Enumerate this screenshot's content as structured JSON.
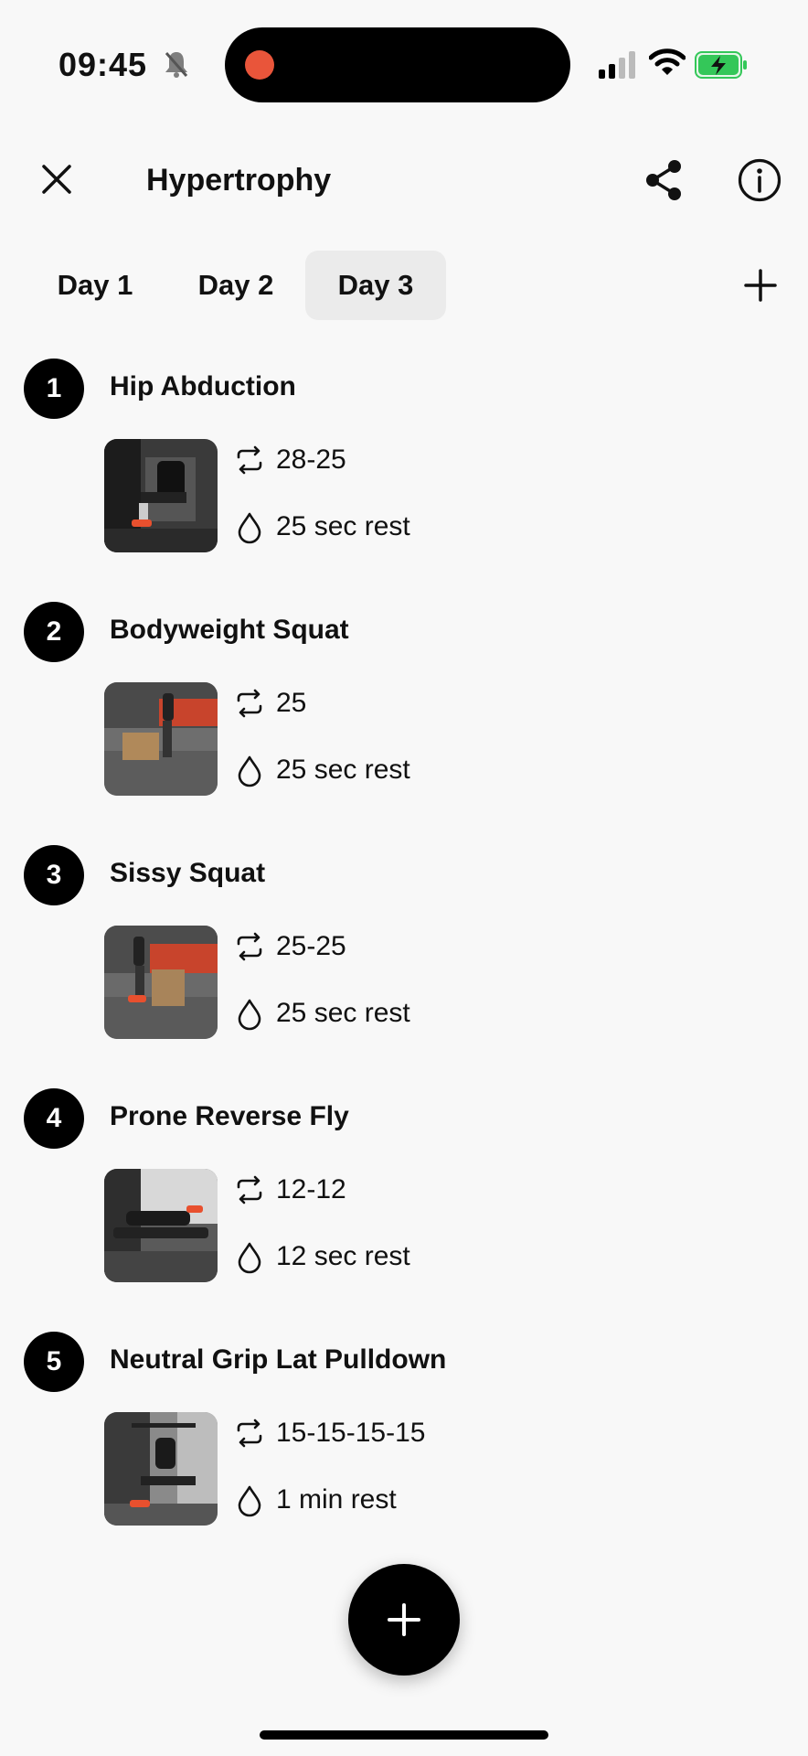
{
  "status_bar": {
    "time": "09:45",
    "bell_icon": "bell-slash-icon",
    "signal_icon": "cellular-signal-icon",
    "wifi_icon": "wifi-icon",
    "battery_icon": "battery-charging-icon",
    "recording_color": "#e9553a",
    "battery_color": "#34c759"
  },
  "header": {
    "title": "Hypertrophy",
    "close_icon": "close-icon",
    "share_icon": "share-icon",
    "info_icon": "info-icon"
  },
  "tabs": [
    {
      "label": "Day 1",
      "active": false
    },
    {
      "label": "Day 2",
      "active": false
    },
    {
      "label": "Day 3",
      "active": true
    }
  ],
  "add_day_icon": "plus-icon",
  "exercises": [
    {
      "number": "1",
      "name": "Hip Abduction",
      "reps": "28-25",
      "rest": "25 sec rest"
    },
    {
      "number": "2",
      "name": "Bodyweight Squat",
      "reps": "25",
      "rest": "25 sec rest"
    },
    {
      "number": "3",
      "name": "Sissy Squat",
      "reps": "25-25",
      "rest": "25 sec rest"
    },
    {
      "number": "4",
      "name": "Prone Reverse Fly",
      "reps": "12-12",
      "rest": "12 sec rest"
    },
    {
      "number": "5",
      "name": "Neutral Grip Lat Pulldown",
      "reps": "15-15-15-15",
      "rest": "1 min rest"
    }
  ],
  "fab_icon": "plus-icon",
  "colors": {
    "background": "#f8f8f8",
    "accent": "#000000",
    "active_tab": "#ebebeb",
    "shoe_accent": "#e8502e"
  }
}
